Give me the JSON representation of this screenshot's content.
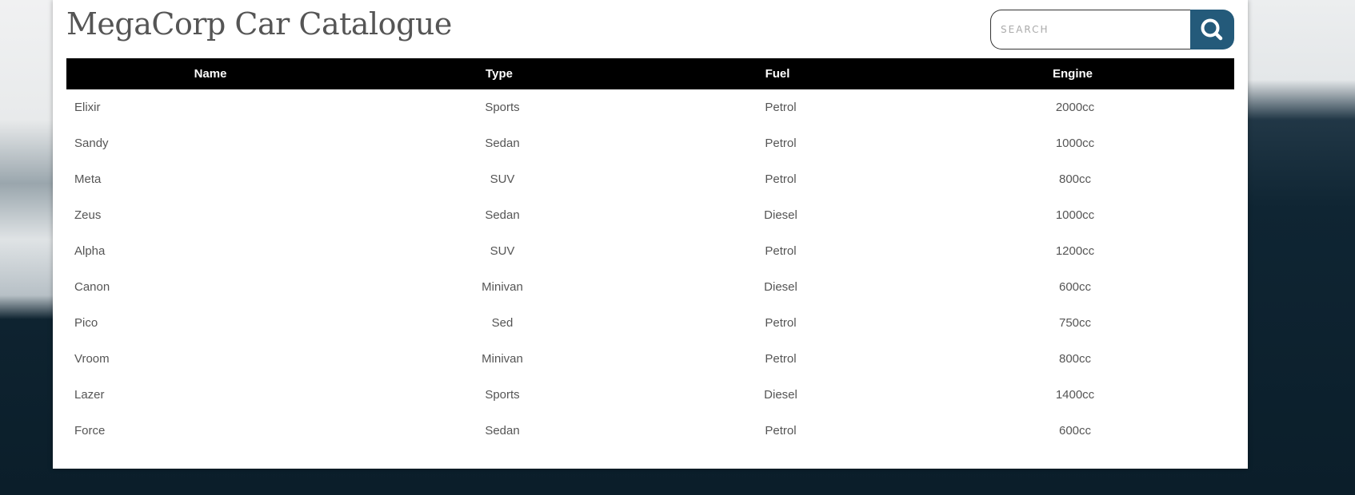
{
  "header": {
    "title": "MegaCorp Car Catalogue"
  },
  "search": {
    "placeholder": "SEARCH",
    "value": "",
    "button_icon": "search-icon",
    "button_color": "#245a7a"
  },
  "table": {
    "columns": [
      "Name",
      "Type",
      "Fuel",
      "Engine"
    ],
    "rows": [
      [
        "Elixir",
        "Sports",
        "Petrol",
        "2000cc"
      ],
      [
        "Sandy",
        "Sedan",
        "Petrol",
        "1000cc"
      ],
      [
        "Meta",
        "SUV",
        "Petrol",
        "800cc"
      ],
      [
        "Zeus",
        "Sedan",
        "Diesel",
        "1000cc"
      ],
      [
        "Alpha",
        "SUV",
        "Petrol",
        "1200cc"
      ],
      [
        "Canon",
        "Minivan",
        "Diesel",
        "600cc"
      ],
      [
        "Pico",
        "Sed",
        "Petrol",
        "750cc"
      ],
      [
        "Vroom",
        "Minivan",
        "Petrol",
        "800cc"
      ],
      [
        "Lazer",
        "Sports",
        "Diesel",
        "1400cc"
      ],
      [
        "Force",
        "Sedan",
        "Petrol",
        "600cc"
      ]
    ]
  }
}
